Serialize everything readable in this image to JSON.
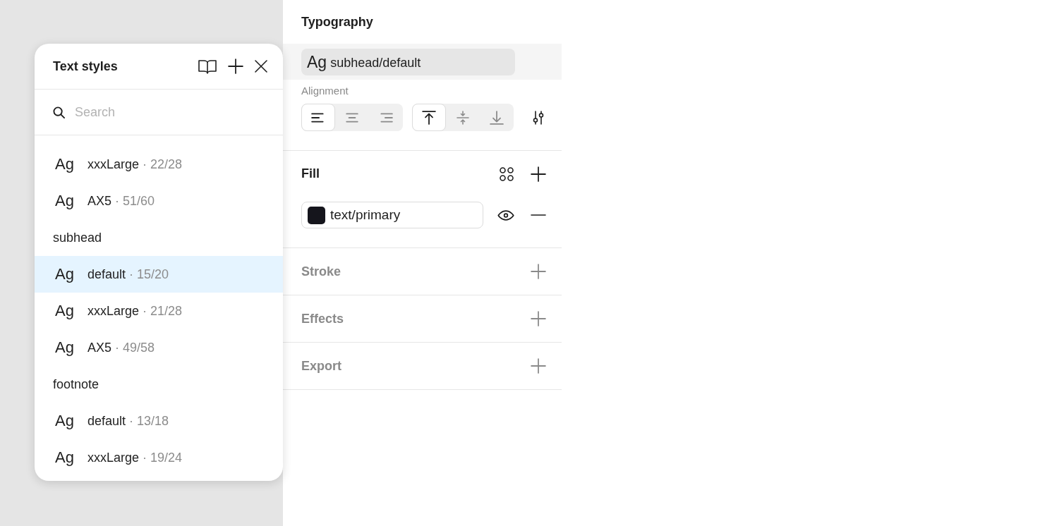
{
  "text_styles_popup": {
    "title": "Text styles",
    "search": {
      "placeholder": "Search"
    },
    "items": [
      {
        "kind": "style",
        "sample": "Ag",
        "name": "xxxLarge",
        "metrics": "· 22/28",
        "selected": false
      },
      {
        "kind": "style",
        "sample": "Ag",
        "name": "AX5",
        "metrics": "· 51/60",
        "selected": false
      },
      {
        "kind": "group",
        "label": "subhead"
      },
      {
        "kind": "style",
        "sample": "Ag",
        "name": "default",
        "metrics": "· 15/20",
        "selected": true
      },
      {
        "kind": "style",
        "sample": "Ag",
        "name": "xxxLarge",
        "metrics": "· 21/28",
        "selected": false
      },
      {
        "kind": "style",
        "sample": "Ag",
        "name": "AX5",
        "metrics": "· 49/58",
        "selected": false
      },
      {
        "kind": "group",
        "label": "footnote"
      },
      {
        "kind": "style",
        "sample": "Ag",
        "name": "default",
        "metrics": "· 13/18",
        "selected": false
      },
      {
        "kind": "style",
        "sample": "Ag",
        "name": "xxxLarge",
        "metrics": "· 19/24",
        "selected": false
      }
    ]
  },
  "properties": {
    "typography": {
      "title": "Typography",
      "style": {
        "sample": "Ag",
        "name": "subhead/default"
      },
      "alignment": {
        "label": "Alignment",
        "horizontal": [
          {
            "kind": "left",
            "selected": true
          },
          {
            "kind": "center",
            "selected": false
          },
          {
            "kind": "right",
            "selected": false
          }
        ],
        "vertical": [
          {
            "kind": "top",
            "selected": true
          },
          {
            "kind": "middle",
            "selected": false
          },
          {
            "kind": "bottom",
            "selected": false
          }
        ]
      }
    },
    "fill": {
      "title": "Fill",
      "paints": [
        {
          "color": "#15151c",
          "name": "text/primary",
          "visible": true
        }
      ]
    },
    "empty_sections": [
      {
        "title": "Stroke"
      },
      {
        "title": "Effects"
      },
      {
        "title": "Export"
      }
    ]
  }
}
